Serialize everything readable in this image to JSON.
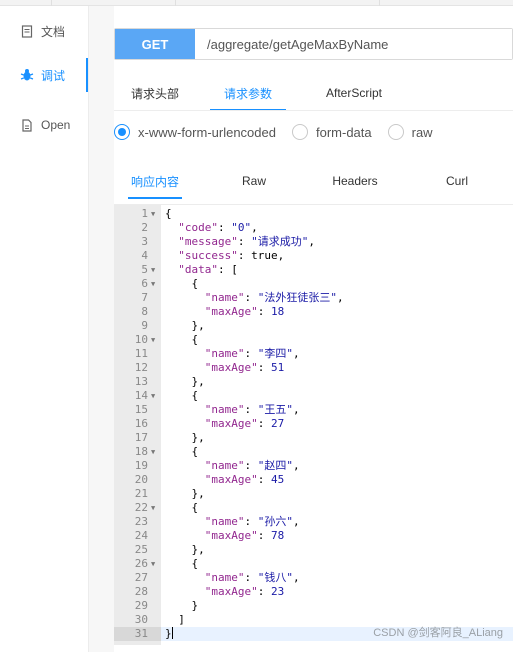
{
  "sidebar": {
    "items": [
      {
        "label": "文档",
        "icon": "document-icon",
        "active": false
      },
      {
        "label": "调试",
        "icon": "bug-icon",
        "active": true
      },
      {
        "label": "Open",
        "icon": "file-icon",
        "active": false
      }
    ]
  },
  "request": {
    "method": "GET",
    "url": "/aggregate/getAgeMaxByName"
  },
  "request_tabs": [
    {
      "label": "请求头部",
      "active": false
    },
    {
      "label": "请求参数",
      "active": true
    },
    {
      "label": "AfterScript",
      "active": false
    }
  ],
  "body_types": [
    {
      "label": "x-www-form-urlencoded",
      "checked": true
    },
    {
      "label": "form-data",
      "checked": false
    },
    {
      "label": "raw",
      "checked": false
    }
  ],
  "response_tabs": [
    {
      "label": "响应内容",
      "active": true
    },
    {
      "label": "Raw",
      "active": false
    },
    {
      "label": "Headers",
      "active": false
    },
    {
      "label": "Curl",
      "active": false
    }
  ],
  "response_lines": [
    {
      "n": "1",
      "fold": true,
      "text": "{"
    },
    {
      "n": "2",
      "fold": false,
      "text": "  \"code\": \"0\","
    },
    {
      "n": "3",
      "fold": false,
      "text": "  \"message\": \"请求成功\","
    },
    {
      "n": "4",
      "fold": false,
      "text": "  \"success\": true,"
    },
    {
      "n": "5",
      "fold": true,
      "text": "  \"data\": ["
    },
    {
      "n": "6",
      "fold": true,
      "text": "    {"
    },
    {
      "n": "7",
      "fold": false,
      "text": "      \"name\": \"法外狂徒张三\","
    },
    {
      "n": "8",
      "fold": false,
      "text": "      \"maxAge\": 18"
    },
    {
      "n": "9",
      "fold": false,
      "text": "    },"
    },
    {
      "n": "10",
      "fold": true,
      "text": "    {"
    },
    {
      "n": "11",
      "fold": false,
      "text": "      \"name\": \"李四\","
    },
    {
      "n": "12",
      "fold": false,
      "text": "      \"maxAge\": 51"
    },
    {
      "n": "13",
      "fold": false,
      "text": "    },"
    },
    {
      "n": "14",
      "fold": true,
      "text": "    {"
    },
    {
      "n": "15",
      "fold": false,
      "text": "      \"name\": \"王五\","
    },
    {
      "n": "16",
      "fold": false,
      "text": "      \"maxAge\": 27"
    },
    {
      "n": "17",
      "fold": false,
      "text": "    },"
    },
    {
      "n": "18",
      "fold": true,
      "text": "    {"
    },
    {
      "n": "19",
      "fold": false,
      "text": "      \"name\": \"赵四\","
    },
    {
      "n": "20",
      "fold": false,
      "text": "      \"maxAge\": 45"
    },
    {
      "n": "21",
      "fold": false,
      "text": "    },"
    },
    {
      "n": "22",
      "fold": true,
      "text": "    {"
    },
    {
      "n": "23",
      "fold": false,
      "text": "      \"name\": \"孙六\","
    },
    {
      "n": "24",
      "fold": false,
      "text": "      \"maxAge\": 78"
    },
    {
      "n": "25",
      "fold": false,
      "text": "    },"
    },
    {
      "n": "26",
      "fold": true,
      "text": "    {"
    },
    {
      "n": "27",
      "fold": false,
      "text": "      \"name\": \"钱八\","
    },
    {
      "n": "28",
      "fold": false,
      "text": "      \"maxAge\": 23"
    },
    {
      "n": "29",
      "fold": false,
      "text": "    }"
    },
    {
      "n": "30",
      "fold": false,
      "text": "  ]"
    },
    {
      "n": "31",
      "fold": false,
      "text": "}"
    }
  ],
  "watermark": "CSDN @剑客阿良_ALiang",
  "colors": {
    "accent": "#1890ff",
    "method_bg": "#5aa7f5"
  }
}
